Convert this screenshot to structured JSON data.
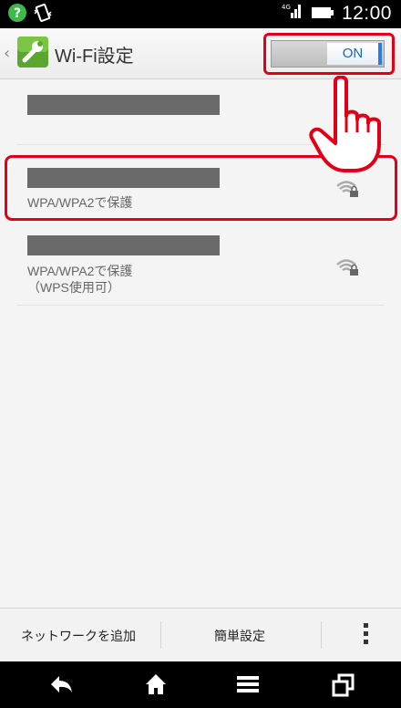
{
  "status_bar": {
    "time": "12:00",
    "icons": [
      "app-notification-icon",
      "vibrate-icon",
      "signal-icon",
      "battery-icon"
    ]
  },
  "action_bar": {
    "back_icon": "chevron-left-icon",
    "app_icon": "wrench-settings-icon",
    "title": "Wi-Fi設定",
    "toggle_label": "ON"
  },
  "networks": [
    {
      "ssid": "",
      "security": ""
    },
    {
      "ssid": "",
      "security": "WPA/WPA2で保護",
      "signal_icon": "wifi-locked-icon"
    },
    {
      "ssid": "",
      "security": "WPA/WPA2で保護",
      "security_extra": "（WPS使用可）",
      "signal_icon": "wifi-locked-icon"
    }
  ],
  "bottom_actions": {
    "add_network": "ネットワークを追加",
    "easy_setup": "簡単設定",
    "more_icon": "overflow-menu-icon"
  },
  "nav_bar": [
    "back-icon",
    "home-icon",
    "menu-icon",
    "recent-apps-icon"
  ],
  "colors": {
    "highlight": "#e30016",
    "toggle_accent": "#2e7be0"
  }
}
